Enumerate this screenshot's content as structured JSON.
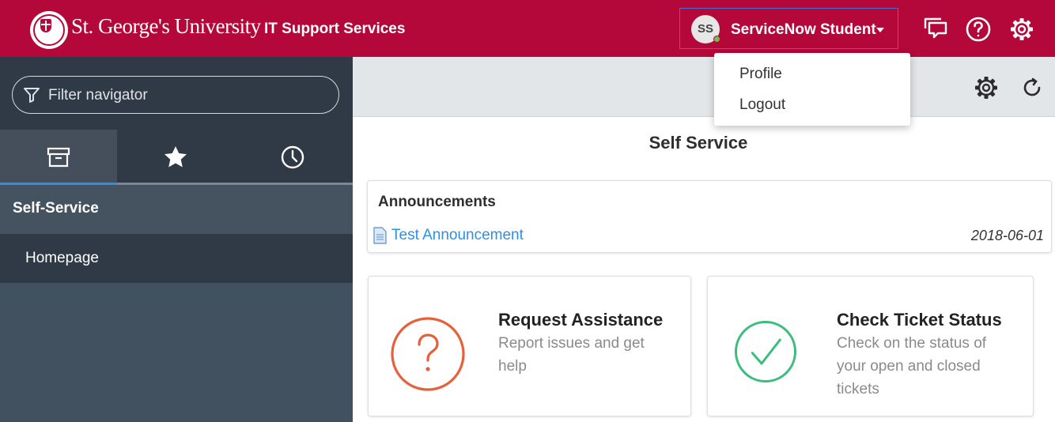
{
  "header": {
    "brand": "St. George's University",
    "app_title": "IT Support Services",
    "user": {
      "initials": "SS",
      "name": "ServiceNow Student"
    },
    "icons": [
      "chat-icon",
      "help-icon",
      "settings-icon"
    ],
    "color": "#b4073a"
  },
  "user_dropdown": {
    "items": [
      {
        "label": "Profile"
      },
      {
        "label": "Logout"
      }
    ]
  },
  "sidebar": {
    "filter_placeholder": "Filter navigator",
    "tabs": [
      {
        "icon": "archive-icon",
        "active": true
      },
      {
        "icon": "star-icon",
        "active": false
      },
      {
        "icon": "clock-icon",
        "active": false
      }
    ],
    "section": "Self-Service",
    "items": [
      {
        "label": "Homepage"
      }
    ]
  },
  "main": {
    "toolbar_icons": [
      "settings-icon",
      "refresh-icon"
    ],
    "title": "Self Service",
    "announcements": {
      "title": "Announcements",
      "items": [
        {
          "label": "Test Announcement",
          "date": "2018-06-01"
        }
      ]
    },
    "tiles": [
      {
        "title": "Request Assistance",
        "description": "Report issues and get help",
        "icon": "question-circle-icon",
        "color": "#e6603b"
      },
      {
        "title": "Check Ticket Status",
        "description": "Check on the status of your open and closed tickets",
        "icon": "check-circle-icon",
        "color": "#3dbd7d"
      }
    ]
  }
}
